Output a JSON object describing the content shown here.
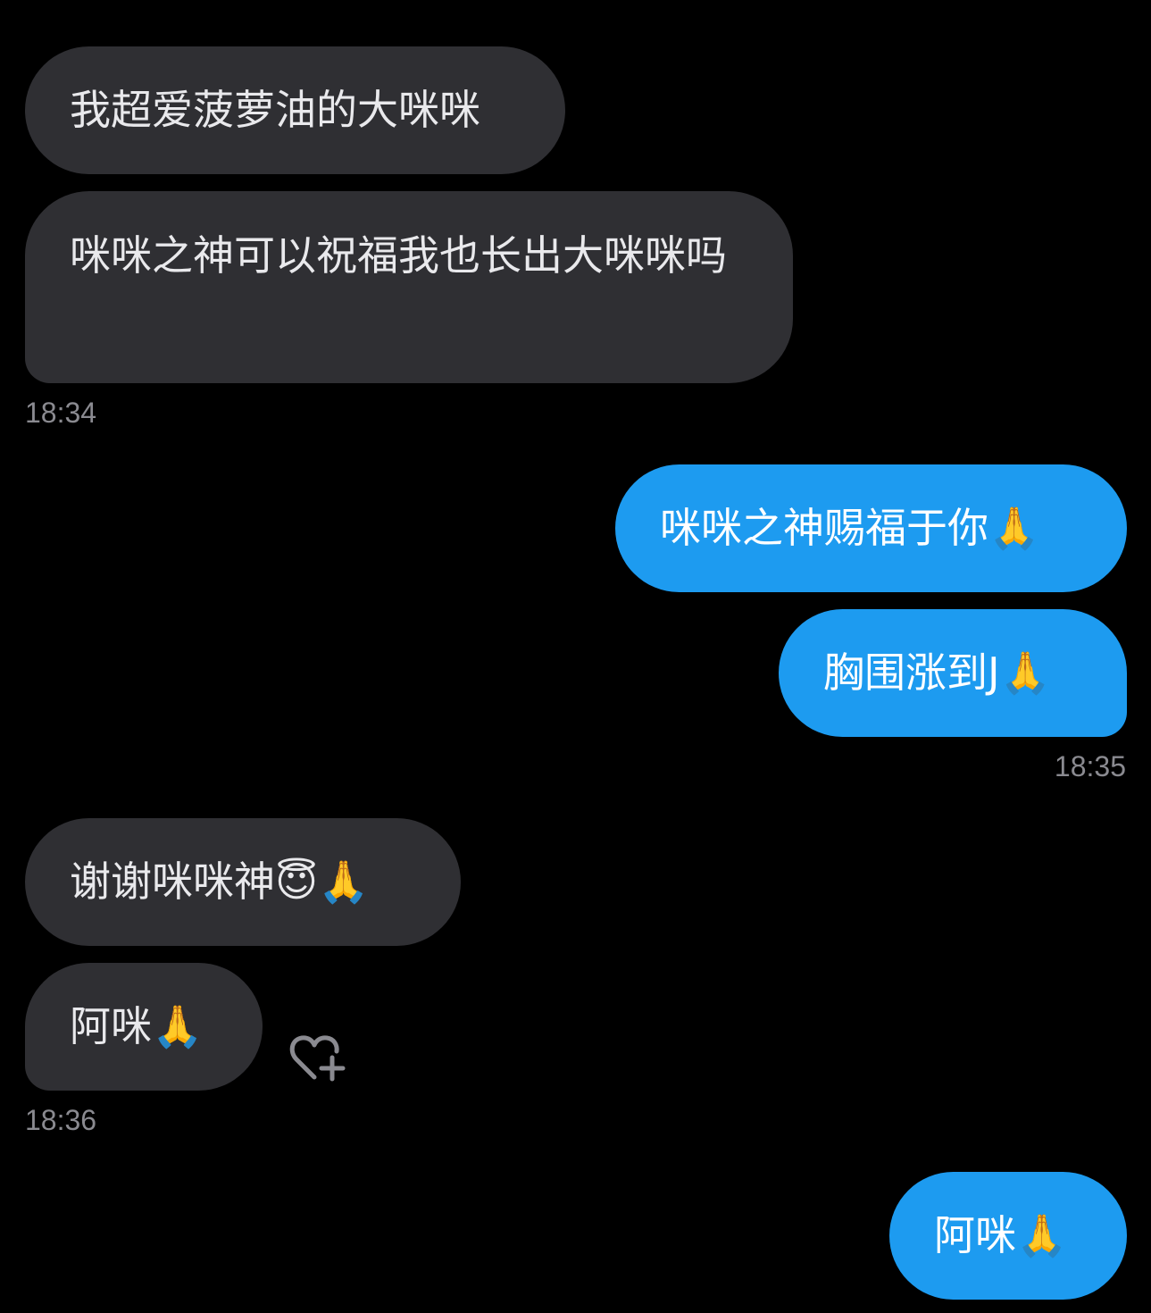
{
  "messages": [
    {
      "side": "in",
      "text": "我超爱菠萝油的大咪咪"
    },
    {
      "side": "in",
      "text": "咪咪之神可以祝福我也长出大咪咪吗"
    },
    {
      "side": "out",
      "text": "咪咪之神赐福于你🙏"
    },
    {
      "side": "out",
      "text": "胸围涨到J🙏"
    },
    {
      "side": "in",
      "text": "谢谢咪咪神😇🙏"
    },
    {
      "side": "in",
      "text": "阿咪🙏"
    },
    {
      "side": "out",
      "text": "阿咪🙏"
    }
  ],
  "timestamps": [
    "18:34",
    "18:35",
    "18:36"
  ],
  "icons": {
    "react": "heart-plus-icon"
  },
  "colors": {
    "background": "#000000",
    "incoming_bubble": "#2f2f33",
    "outgoing_bubble": "#1d9bf0",
    "timestamp": "#8a8a90"
  }
}
